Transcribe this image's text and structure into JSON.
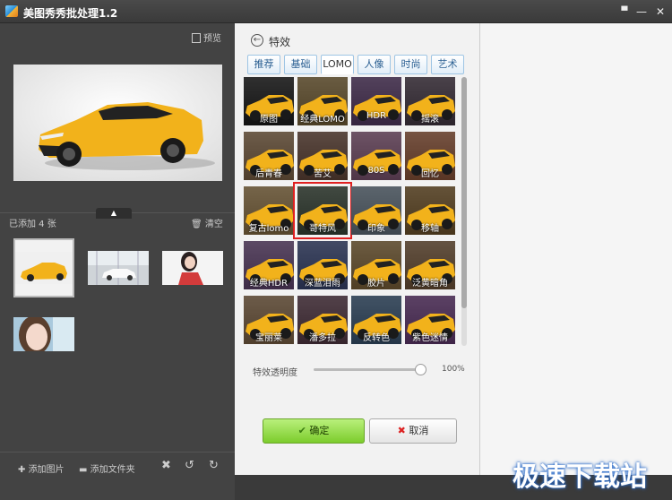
{
  "window": {
    "title": "美图秀秀批处理1.2",
    "controls": [
      "▀",
      "—",
      "✕"
    ]
  },
  "left": {
    "preview_label": "预览",
    "added_label": "已添加 4 张",
    "clear_label": "清空",
    "add_image_label": "添加图片",
    "add_folder_label": "添加文件夹"
  },
  "effects": {
    "title": "特效",
    "tabs": [
      "推荐",
      "基础",
      "LOMO",
      "人像",
      "时尚",
      "艺术"
    ],
    "selected_tab": "LOMO",
    "items": [
      "原图",
      "经典LOMO",
      "HDR",
      "摇滚",
      "后青春",
      "苦艾",
      "80S",
      "回忆",
      "复古lomo",
      "哥特风",
      "印象",
      "移轴",
      "经典HDR",
      "深蓝泪雨",
      "胶片",
      "泛黄暗角",
      "宝丽莱",
      "潘多拉",
      "反转色",
      "紫色迷情"
    ],
    "highlighted": "哥特风",
    "opacity_label": "特效透明度",
    "opacity_value": "100%",
    "opacity_level": 1.0,
    "ok_label": "确定",
    "cancel_label": "取消"
  },
  "watermark": "极速下载站",
  "colors": {
    "accent_ok": "#8fd83c",
    "highlight": "#e02020",
    "tab_border": "#9ec5e4"
  }
}
